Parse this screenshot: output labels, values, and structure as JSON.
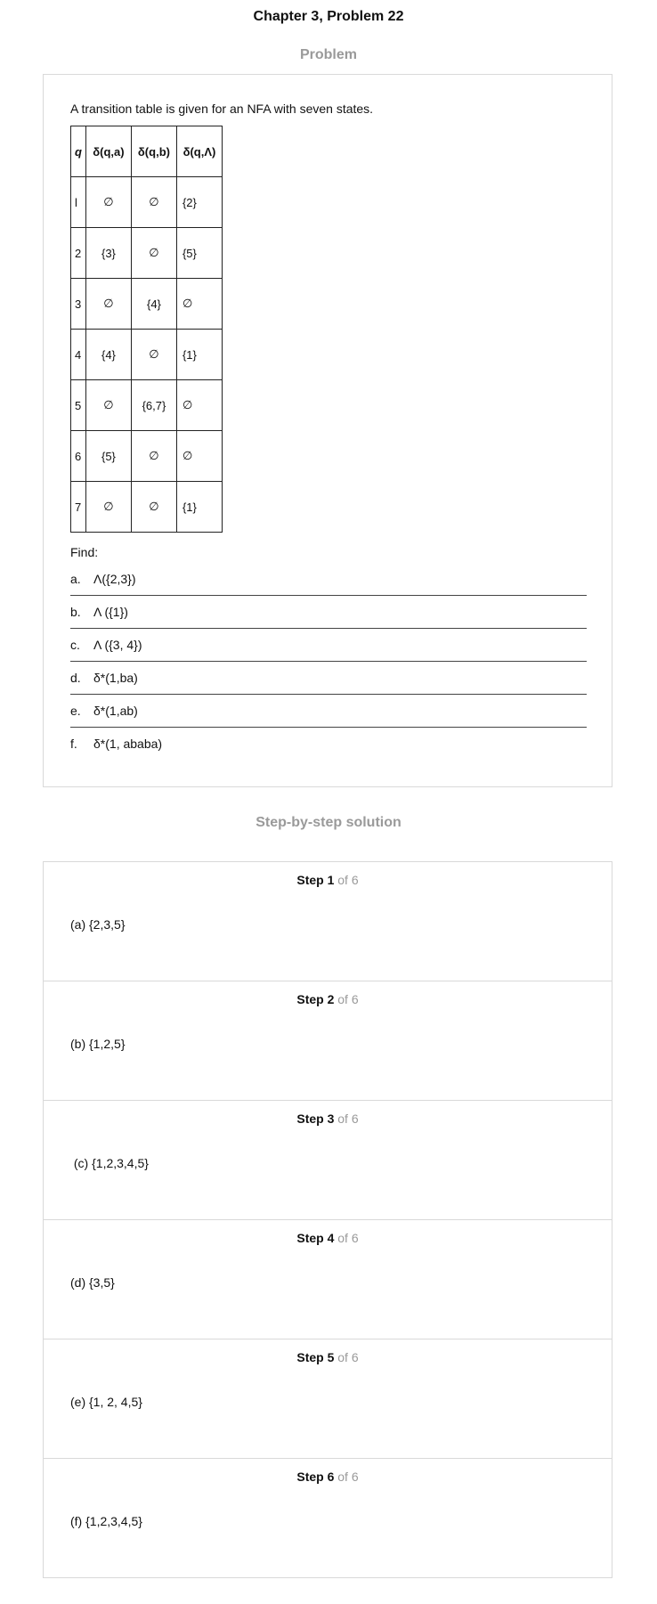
{
  "page": {
    "title": "Chapter 3, Problem 22"
  },
  "problem": {
    "heading": "Problem",
    "intro": "A transition table is given for an NFA with seven states.",
    "table": {
      "headers": [
        "q",
        "δ(q,a)",
        "δ(q,b)",
        "δ(q,Λ)"
      ],
      "rows": [
        [
          "l",
          "∅",
          "∅",
          "{2}"
        ],
        [
          "2",
          "{3}",
          "∅",
          "{5}"
        ],
        [
          "3",
          "∅",
          "{4}",
          "∅"
        ],
        [
          "4",
          "{4}",
          "∅",
          "{1}"
        ],
        [
          "5",
          "∅",
          "{6,7}",
          "∅"
        ],
        [
          "6",
          "{5}",
          "∅",
          "∅"
        ],
        [
          "7",
          "∅",
          "∅",
          "{1}"
        ]
      ]
    },
    "find_label": "Find:",
    "parts": [
      {
        "letter": "a.",
        "text": "Λ({2,3})"
      },
      {
        "letter": "b.",
        "text": "Λ ({1})"
      },
      {
        "letter": "c.",
        "text": "Λ ({3, 4})"
      },
      {
        "letter": "d.",
        "text": "δ*(1,ba)"
      },
      {
        "letter": "e.",
        "text": "δ*(1,ab)"
      },
      {
        "letter": "f.",
        "text": "δ*(1, ababa)"
      }
    ]
  },
  "solution": {
    "heading": "Step-by-step solution",
    "steps": [
      {
        "label": "Step 1",
        "of": "of 6",
        "answer": "(a) {2,3,5}"
      },
      {
        "label": "Step 2",
        "of": "of 6",
        "answer": "(b) {1,2,5}"
      },
      {
        "label": "Step 3",
        "of": "of 6",
        "answer": " (c) {1,2,3,4,5}"
      },
      {
        "label": "Step 4",
        "of": "of 6",
        "answer": "(d) {3,5}"
      },
      {
        "label": "Step 5",
        "of": "of 6",
        "answer": "(e) {1, 2, 4,5}"
      },
      {
        "label": "Step 6",
        "of": "of 6",
        "answer": "(f) {1,2,3,4,5}"
      }
    ]
  }
}
